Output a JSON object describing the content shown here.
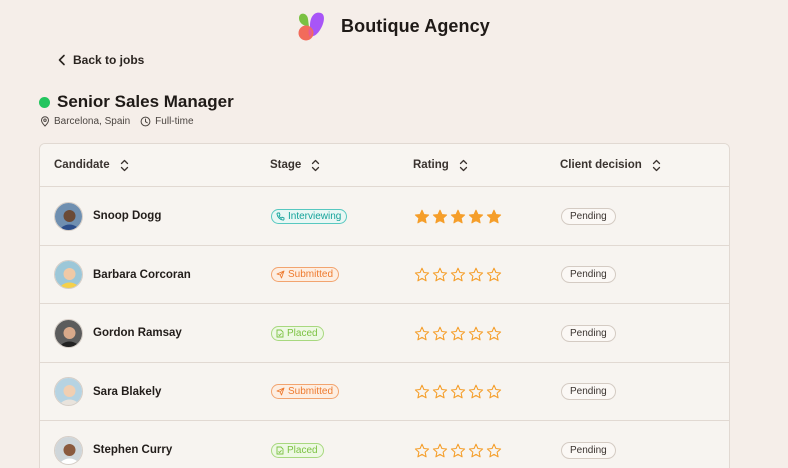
{
  "brand": {
    "name": "Boutique Agency"
  },
  "nav": {
    "back_label": "Back to jobs"
  },
  "job": {
    "title": "Senior Sales Manager",
    "location": "Barcelona, Spain",
    "type": "Full-time",
    "status_color": "#22c55e"
  },
  "table": {
    "columns": [
      "Candidate",
      "Stage",
      "Rating",
      "Client decision"
    ],
    "rows": [
      {
        "name": "Snoop Dogg",
        "stage": "Interviewing",
        "stage_kind": "interviewing",
        "rating": 5,
        "decision": "Pending"
      },
      {
        "name": "Barbara Corcoran",
        "stage": "Submitted",
        "stage_kind": "submitted",
        "rating": 0,
        "decision": "Pending"
      },
      {
        "name": "Gordon Ramsay",
        "stage": "Placed",
        "stage_kind": "placed",
        "rating": 0,
        "decision": "Pending"
      },
      {
        "name": "Sara Blakely",
        "stage": "Submitted",
        "stage_kind": "submitted",
        "rating": 0,
        "decision": "Pending"
      },
      {
        "name": "Stephen Curry",
        "stage": "Placed",
        "stage_kind": "placed",
        "rating": 0,
        "decision": "Pending"
      }
    ]
  },
  "colors": {
    "background": "#f5eee9",
    "star": "#f59e2a",
    "interviewing": "#14a39a",
    "submitted": "#ee7a2e",
    "placed": "#7cc243"
  }
}
